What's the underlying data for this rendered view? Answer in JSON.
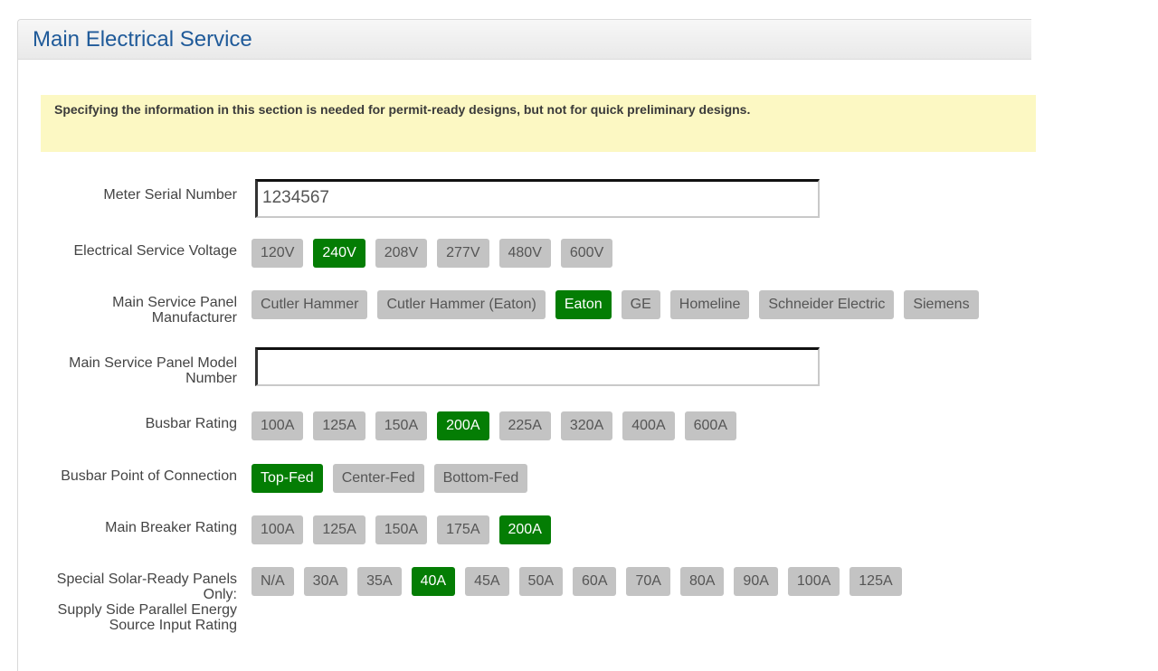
{
  "panel": {
    "title": "Main Electrical Service"
  },
  "notice": {
    "text": "Specifying the information in this section is needed for permit-ready designs, but not for quick preliminary designs."
  },
  "fields": {
    "meter_serial": {
      "label": "Meter Serial Number",
      "value": "1234567"
    },
    "voltage": {
      "label": "Electrical Service Voltage",
      "options": [
        "120V",
        "240V",
        "208V",
        "277V",
        "480V",
        "600V"
      ],
      "selected": "240V"
    },
    "manufacturer": {
      "label_line1": "Main Service Panel",
      "label_line2": "Manufacturer",
      "options": [
        "Cutler Hammer",
        "Cutler Hammer (Eaton)",
        "Eaton",
        "GE",
        "Homeline",
        "Schneider Electric",
        "Siemens"
      ],
      "selected": "Eaton"
    },
    "model_number": {
      "label_line1": "Main Service Panel Model",
      "label_line2": "Number",
      "value": ""
    },
    "busbar_rating": {
      "label": "Busbar Rating",
      "options": [
        "100A",
        "125A",
        "150A",
        "200A",
        "225A",
        "320A",
        "400A",
        "600A"
      ],
      "selected": "200A"
    },
    "busbar_connection": {
      "label": "Busbar Point of Connection",
      "options": [
        "Top-Fed",
        "Center-Fed",
        "Bottom-Fed"
      ],
      "selected": "Top-Fed"
    },
    "main_breaker": {
      "label": "Main Breaker Rating",
      "options": [
        "100A",
        "125A",
        "150A",
        "175A",
        "200A"
      ],
      "selected": "200A"
    },
    "solar_ready": {
      "label_line1": "Special Solar-Ready Panels",
      "label_line2": "Only:",
      "label_line3": "Supply Side Parallel Energy",
      "label_line4": "Source Input Rating",
      "options": [
        "N/A",
        "30A",
        "35A",
        "40A",
        "45A",
        "50A",
        "60A",
        "70A",
        "80A",
        "90A",
        "100A",
        "125A"
      ],
      "selected": "40A"
    }
  },
  "colors": {
    "selected_bg": "#047d04",
    "option_bg": "#c3c3c3",
    "title": "#1f5a99",
    "notice_bg": "#fcf8c3"
  }
}
